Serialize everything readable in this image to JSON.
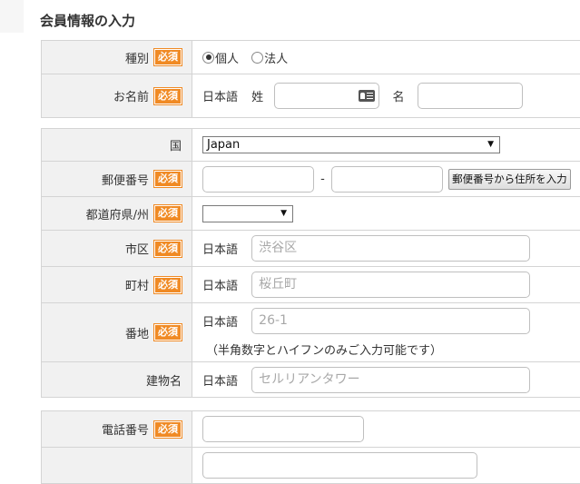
{
  "page": {
    "title": "会員情報の入力"
  },
  "required_label": "必須",
  "lang_ja": "日本語",
  "type_row": {
    "label": "種別",
    "options": [
      "個人",
      "法人"
    ],
    "selected": 0
  },
  "name_row": {
    "label": "お名前",
    "sei": "姓",
    "mei": "名"
  },
  "country_row": {
    "label": "国",
    "value": "Japan"
  },
  "postal_row": {
    "label": "郵便番号",
    "separator": "-",
    "button": "郵便番号から住所を入力"
  },
  "pref_row": {
    "label": "都道府県/州",
    "value": ""
  },
  "city_row": {
    "label": "市区",
    "placeholder": "渋谷区"
  },
  "town_row": {
    "label": "町村",
    "placeholder": "桜丘町"
  },
  "addr_row": {
    "label": "番地",
    "placeholder": "26-1",
    "note": "（半角数字とハイフンのみご入力可能です）"
  },
  "bldg_row": {
    "label": "建物名",
    "placeholder": "セルリアンタワー"
  },
  "phone_row": {
    "label": "電話番号"
  },
  "icons": {
    "card": "contact-card-icon",
    "dropdown": "dropdown-arrow-icon"
  },
  "colors": {
    "required_badge": "#f08a24",
    "label_bg": "#f1f1f1"
  }
}
